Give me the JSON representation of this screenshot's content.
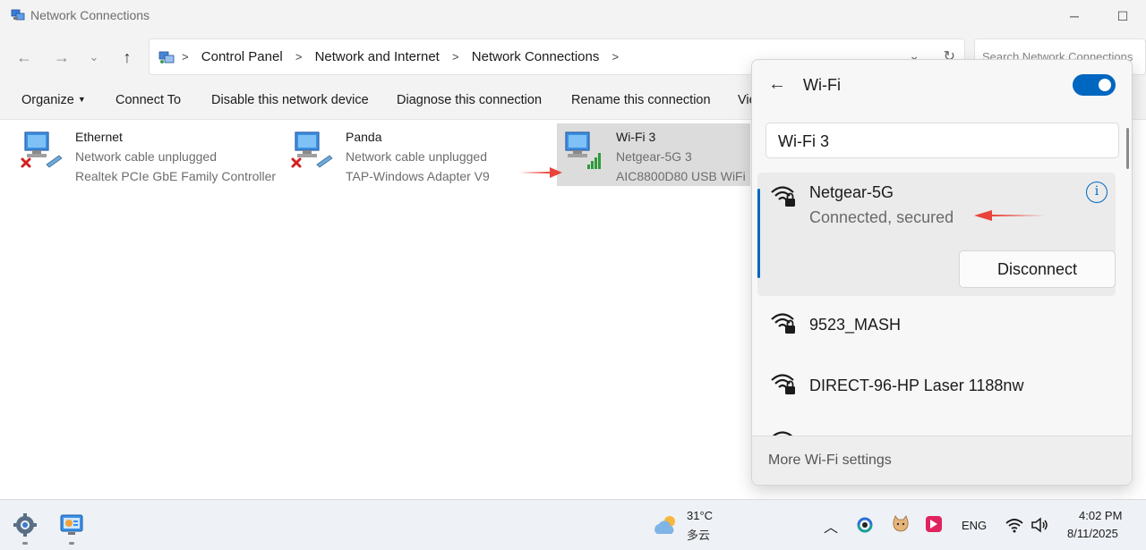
{
  "window": {
    "title": "Network Connections"
  },
  "address": {
    "crumbs": [
      "Control Panel",
      "Network and Internet",
      "Network Connections"
    ],
    "search_placeholder": "Search Network Connections"
  },
  "commands": {
    "organize": "Organize",
    "connect_to": "Connect To",
    "disable": "Disable this network device",
    "diagnose": "Diagnose this connection",
    "rename": "Rename this connection",
    "view_partial": "Vie"
  },
  "adapters": [
    {
      "name": "Ethernet",
      "status": "Network cable unplugged",
      "device": "Realtek PCIe GbE Family Controller"
    },
    {
      "name": "Panda",
      "status": "Network cable unplugged",
      "device": "TAP-Windows Adapter V9"
    },
    {
      "name": "Wi-Fi 3",
      "status": "Netgear-5G 3",
      "device": "AIC8800D80 USB WiFi"
    }
  ],
  "wifi_flyout": {
    "title": "Wi-Fi",
    "toggle_on": true,
    "adapter": "Wi-Fi 3",
    "connected": {
      "ssid": "Netgear-5G",
      "state": "Connected, secured",
      "disconnect_label": "Disconnect"
    },
    "networks": [
      {
        "ssid": "9523_MASH"
      },
      {
        "ssid": "DIRECT-96-HP Laser 1188nw"
      }
    ],
    "footer": "More Wi-Fi settings"
  },
  "taskbar": {
    "weather": {
      "temp": "31°C",
      "desc": "多云"
    },
    "language": "ENG",
    "time": "4:02 PM",
    "date": "8/11/2025"
  },
  "colors": {
    "accent": "#0067c0",
    "annotation_arrow": "#e8443a",
    "selected_tile": "#dcdcdc"
  }
}
